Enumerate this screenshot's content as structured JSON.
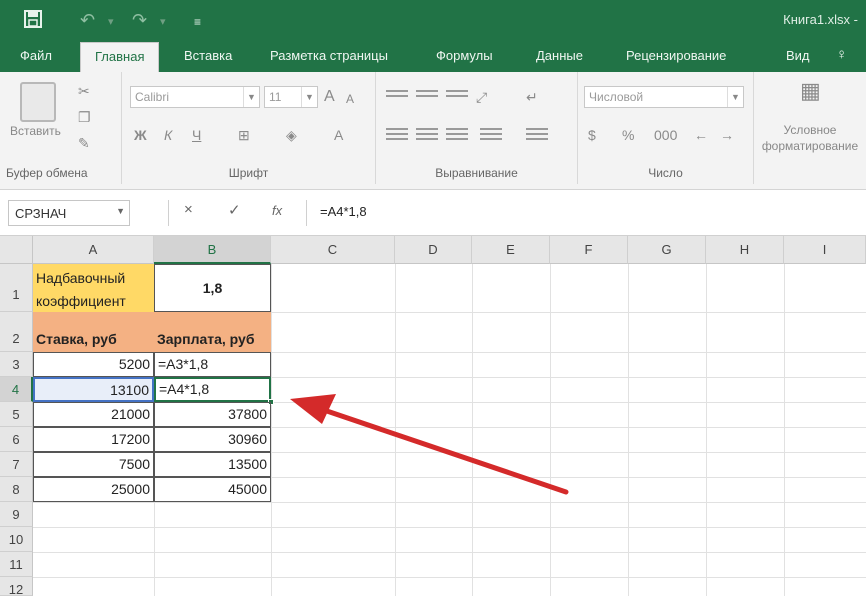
{
  "titlebar": {
    "save_icon": "save-icon",
    "undo_icon": "undo-icon",
    "redo_icon": "redo-icon",
    "customize_icon": "customize-icon",
    "title": "Книга1.xlsx -"
  },
  "tabs": [
    {
      "label": "Файл"
    },
    {
      "label": "Главная"
    },
    {
      "label": "Вставка"
    },
    {
      "label": "Разметка страницы"
    },
    {
      "label": "Формулы"
    },
    {
      "label": "Данные"
    },
    {
      "label": "Рецензирование"
    },
    {
      "label": "Вид"
    }
  ],
  "ribbon": {
    "clipboard": {
      "paste_label": "Вставить",
      "group_label": "Буфер обмена"
    },
    "font": {
      "font_name": "Calibri",
      "font_size": "11",
      "bold": "Ж",
      "italic": "К",
      "underline": "Ч",
      "group_label": "Шрифт"
    },
    "alignment": {
      "group_label": "Выравнивание"
    },
    "number": {
      "format": "Числовой",
      "group_label": "Число"
    },
    "styles": {
      "condfmt_line1": "Условное",
      "condfmt_line2": "форматирование"
    }
  },
  "formula_bar": {
    "name_box": "СРЗНАЧ",
    "cancel_icon": "×",
    "enter_icon": "✓",
    "fx_label": "fx",
    "formula": "=А4*1,8"
  },
  "columns": [
    "A",
    "B",
    "C",
    "D",
    "E",
    "F",
    "G",
    "H",
    "I"
  ],
  "rows": [
    "1",
    "2",
    "3",
    "4",
    "5",
    "6",
    "7",
    "8",
    "9",
    "10",
    "11",
    "12"
  ],
  "cells": {
    "A1": "Надбавочный коэффициент",
    "B1": "1,8",
    "A2": "Ставка, руб",
    "B2": "Зарплата, руб",
    "A3": "5200",
    "B3": "=А3*1,8",
    "A4": "13100",
    "B4": "=А4*1,8",
    "A5": "21000",
    "B5": "37800",
    "A6": "17200",
    "B6": "30960",
    "A7": "7500",
    "B7": "13500",
    "A8": "25000",
    "B8": "45000"
  },
  "colors": {
    "accent": "#217346",
    "header_yellow": "#ffd966",
    "header_orange": "#f4b183",
    "annotation_arrow": "#d42a2a"
  },
  "annotation": {
    "arrow_icon": "red-arrow-pointer"
  }
}
